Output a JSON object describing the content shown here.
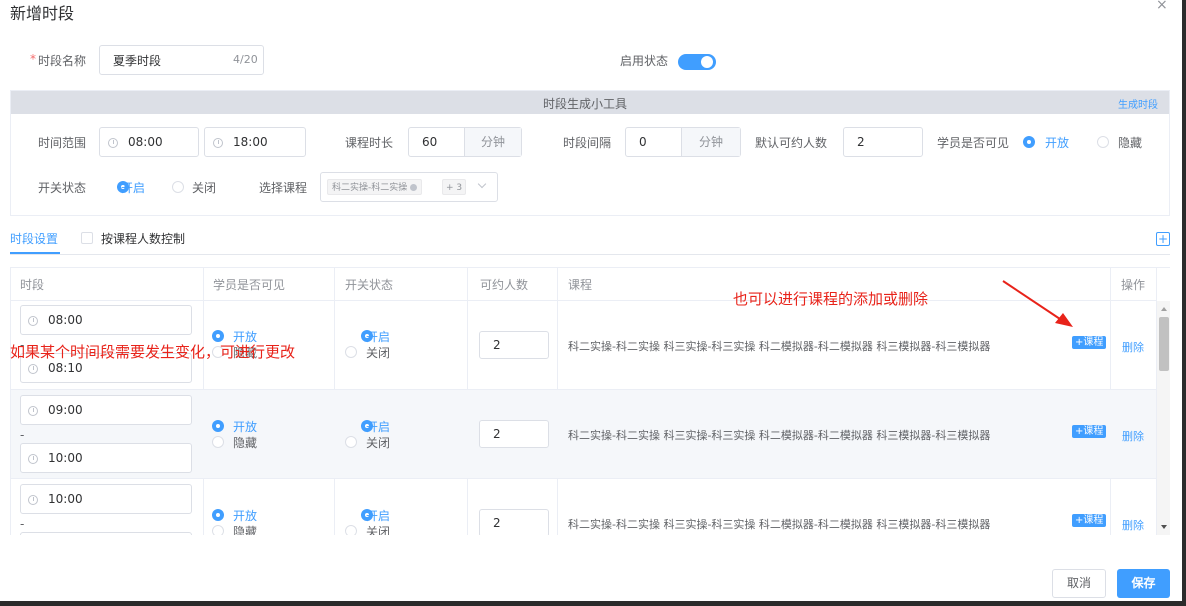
{
  "dialog": {
    "title": "新增时段",
    "close_icon": "close-icon"
  },
  "form": {
    "name_label": "时段名称",
    "name_required_mark": "*",
    "name_value": "夏季时段",
    "name_counter": "4/20",
    "enable_label": "启用状态",
    "enable_on": true
  },
  "tool": {
    "title": "时段生成小工具",
    "generate_link": "生成时段",
    "range_label": "时间范围",
    "range_start": "08:00",
    "range_end": "18:00",
    "duration_label": "课程时长",
    "duration_value": "60",
    "duration_unit": "分钟",
    "interval_label": "时段间隔",
    "interval_value": "0",
    "interval_unit": "分钟",
    "capacity_label": "默认可约人数",
    "capacity_value": "2",
    "visible_label": "学员是否可见",
    "visible_open": "开放",
    "visible_hide": "隐藏",
    "switch_label": "开关状态",
    "switch_on": "开启",
    "switch_off": "关闭",
    "course_label": "选择课程",
    "course_tag": "科二实操-科二实操",
    "course_more": "+ 3"
  },
  "tabs": {
    "active": "时段设置",
    "checkbox_label": "按课程人数控制"
  },
  "table": {
    "headers": [
      "时段",
      "学员是否可见",
      "开关状态",
      "可约人数",
      "课程",
      "操作"
    ],
    "rows": [
      {
        "start": "08:00",
        "sep": "-",
        "end": "08:10",
        "open": "开放",
        "hide": "隐藏",
        "on": "开启",
        "off": "关闭",
        "capacity": "2",
        "courses": "科二实操-科二实操 科三实操-科三实操 科二模拟器-科二模拟器 科三模拟器-科三模拟器",
        "add_course": "+课程",
        "delete": "删除"
      },
      {
        "start": "09:00",
        "sep": "-",
        "end": "10:00",
        "open": "开放",
        "hide": "隐藏",
        "on": "开启",
        "off": "关闭",
        "capacity": "2",
        "courses": "科二实操-科二实操 科三实操-科三实操 科二模拟器-科二模拟器 科三模拟器-科三模拟器",
        "add_course": "+课程",
        "delete": "删除"
      },
      {
        "start": "10:00",
        "sep": "-",
        "end": "",
        "open": "开放",
        "hide": "隐藏",
        "on": "开启",
        "off": "关闭",
        "capacity": "2",
        "courses": "科二实操-科二实操 科三实操-科三实操 科二模拟器-科二模拟器 科三模拟器-科三模拟器",
        "add_course": "+课程",
        "delete": "删除"
      }
    ]
  },
  "annotations": {
    "left": "如果某个时间段需要发生变化，可进行更改",
    "right": "也可以进行课程的添加或删除",
    "color": "#e8231a"
  },
  "footer": {
    "cancel": "取消",
    "save": "保存"
  },
  "colors": {
    "accent": "#409eff",
    "header_bar": "#dcdfe6"
  }
}
